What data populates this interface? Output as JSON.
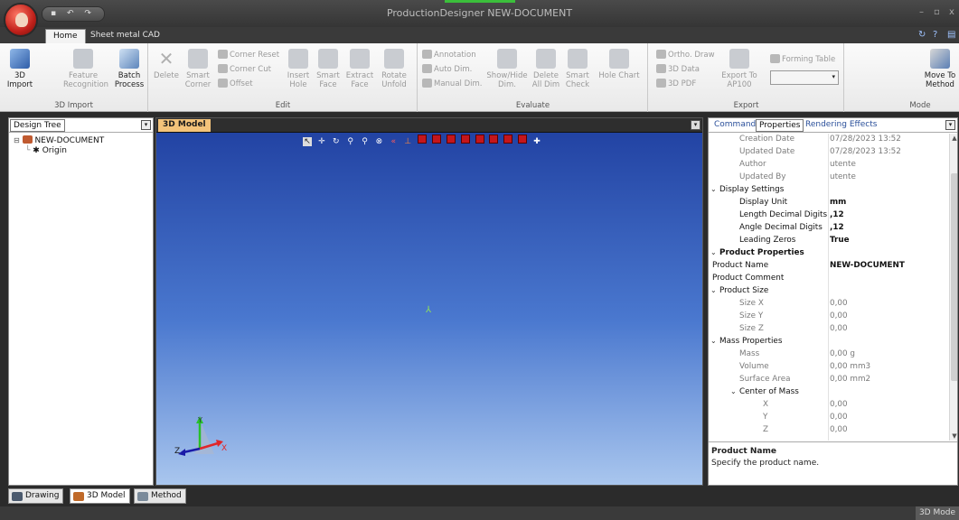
{
  "window": {
    "title": "ProductionDesigner  NEW-DOCUMENT",
    "qat_items": [
      "▪",
      "↶",
      "↷"
    ]
  },
  "ribbon_tabs": [
    "Home",
    "Sheet metal CAD"
  ],
  "ribbon": {
    "import": {
      "label": "3D Import",
      "buttons": [
        {
          "label": "3D Import",
          "enabled": true
        },
        {
          "label": "Feature Recognition",
          "enabled": false
        },
        {
          "label": "Batch Process",
          "enabled": true
        }
      ]
    },
    "edit": {
      "label": "Edit",
      "buttons": [
        {
          "label": "Delete",
          "enabled": false
        },
        {
          "label": "Smart Corner",
          "enabled": false
        },
        {
          "label": "Insert Hole",
          "enabled": false
        },
        {
          "label": "Smart Face",
          "enabled": false
        },
        {
          "label": "Extract Face",
          "enabled": false
        },
        {
          "label": "Rotate Unfold",
          "enabled": false
        }
      ],
      "small_buttons": [
        "Corner Reset",
        "Corner Cut",
        "Offset"
      ]
    },
    "evaluate": {
      "label": "Evaluate",
      "small_buttons": [
        "Annotation",
        "Auto Dim.",
        "Manual Dim."
      ],
      "buttons": [
        {
          "label": "Show/Hide Dim.",
          "enabled": false
        },
        {
          "label": "Delete All Dim",
          "enabled": false
        },
        {
          "label": "Smart Check",
          "enabled": false
        },
        {
          "label": "Hole Chart",
          "enabled": false
        }
      ]
    },
    "export": {
      "label": "Export",
      "small_buttons": [
        "Ortho. Draw",
        "3D Data",
        "3D PDF"
      ],
      "button": {
        "label": "Export To AP100",
        "enabled": false
      },
      "forming_table_label": "Forming Table",
      "combo_value": ""
    },
    "mode": {
      "label": "Mode",
      "button": {
        "label": "Move To Method",
        "enabled": true
      }
    }
  },
  "design_tree": {
    "tab": "Design Tree",
    "items": [
      {
        "label": "NEW-DOCUMENT",
        "icon": "document-icon"
      },
      {
        "label": "Origin",
        "icon": "origin-icon"
      }
    ]
  },
  "viewport": {
    "tab": "3D Model",
    "tools": [
      "pointer",
      "pan",
      "rotate",
      "zoom",
      "zoom-window",
      "zoom-fit",
      "zoom-prev",
      "axis"
    ],
    "view_cubes": 9,
    "axis_labels": {
      "x": "X",
      "y": "Y",
      "z": "Z"
    }
  },
  "right_panel": {
    "tabs": [
      "Command",
      "Properties",
      "Rendering Effects"
    ],
    "active_tab": "Properties",
    "rows": [
      {
        "key": "Creation Date",
        "value": "07/28/2023 13:52",
        "style": "grey",
        "indent": 2
      },
      {
        "key": "Updated Date",
        "value": "07/28/2023 13:52",
        "style": "grey",
        "indent": 2
      },
      {
        "key": "Author",
        "value": "utente",
        "style": "grey",
        "indent": 2
      },
      {
        "key": "Updated By",
        "value": "utente",
        "style": "grey",
        "indent": 2
      },
      {
        "key": "Display Settings",
        "value": "",
        "style": "cat",
        "indent": 1,
        "chevron": "⌄"
      },
      {
        "key": "Display Unit",
        "value": "mm",
        "style": "bold",
        "indent": 2
      },
      {
        "key": "Length Decimal Digits",
        "value": ",12",
        "style": "bold",
        "indent": 2
      },
      {
        "key": "Angle Decimal Digits",
        "value": ",12",
        "style": "bold",
        "indent": 2
      },
      {
        "key": "Leading Zeros",
        "value": "True",
        "style": "bold",
        "indent": 2
      },
      {
        "key": "Product Properties",
        "value": "",
        "style": "catbold",
        "indent": 1,
        "chevron": "⌄"
      },
      {
        "key": "Product Name",
        "value": "NEW-DOCUMENT",
        "style": "bold",
        "indent": 0
      },
      {
        "key": "Product Comment",
        "value": "",
        "style": "dark",
        "indent": 0
      },
      {
        "key": "Product Size",
        "value": "",
        "style": "cat",
        "indent": 1,
        "chevron": "⌄"
      },
      {
        "key": "Size X",
        "value": "0,00",
        "style": "grey",
        "indent": 2
      },
      {
        "key": "Size Y",
        "value": "0,00",
        "style": "grey",
        "indent": 2
      },
      {
        "key": "Size Z",
        "value": "0,00",
        "style": "grey",
        "indent": 2
      },
      {
        "key": "Mass Properties",
        "value": "",
        "style": "cat",
        "indent": 1,
        "chevron": "⌄"
      },
      {
        "key": "Mass",
        "value": "0,00 g",
        "style": "grey",
        "indent": 2
      },
      {
        "key": "Volume",
        "value": "0,00 mm3",
        "style": "grey",
        "indent": 2
      },
      {
        "key": "Surface Area",
        "value": "0,00 mm2",
        "style": "grey",
        "indent": 2
      },
      {
        "key": "Center of Mass",
        "value": "",
        "style": "cat",
        "indent": 2,
        "chevron": "⌄"
      },
      {
        "key": "X",
        "value": "0,00",
        "style": "grey",
        "indent": 3
      },
      {
        "key": "Y",
        "value": "0,00",
        "style": "grey",
        "indent": 3
      },
      {
        "key": "Z",
        "value": "0,00",
        "style": "grey",
        "indent": 3
      }
    ],
    "description": {
      "title": "Product Name",
      "text": "Specify the product name."
    }
  },
  "bottom_tabs": [
    {
      "label": "Drawing",
      "icon": "drawing-icon"
    },
    {
      "label": "3D Model",
      "icon": "cube-icon"
    },
    {
      "label": "Method",
      "icon": "method-icon"
    }
  ],
  "active_bottom_tab": "3D Model",
  "status": {
    "mode": "3D Mode"
  },
  "colors": {
    "accent": "#3bbf3b",
    "viewport_top": "#1f3fa0",
    "viewport_bottom": "#a9c6ee",
    "view_tab": "#f3c37a",
    "cube": "#c4161c"
  }
}
